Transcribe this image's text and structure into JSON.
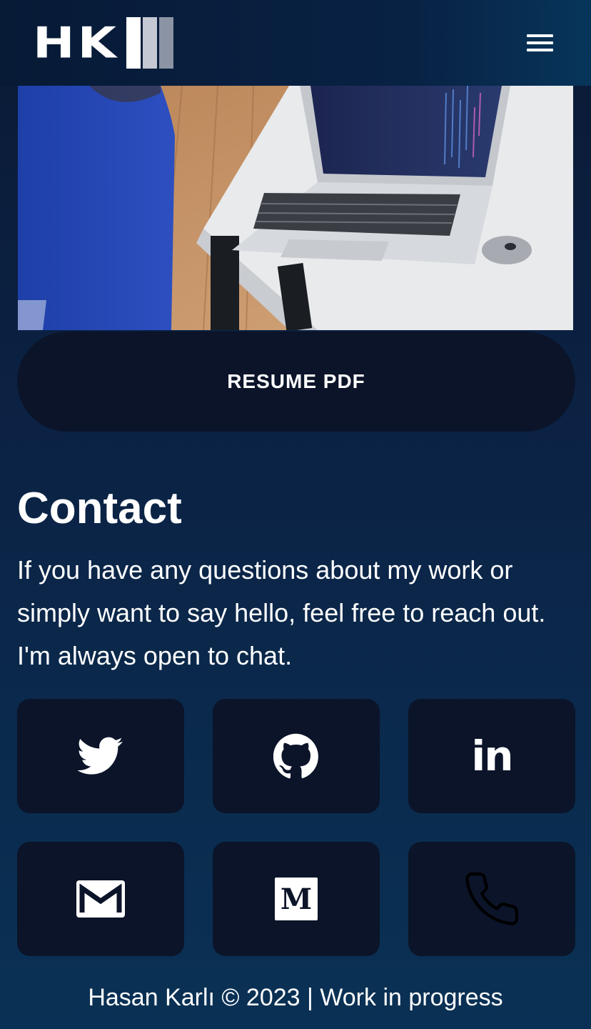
{
  "header": {
    "logo_text": "HK",
    "menu_icon": "hamburger-menu-icon"
  },
  "hero": {
    "image_subject": "person-with-laptop-photo"
  },
  "resume": {
    "label": "RESUME PDF"
  },
  "contact": {
    "title": "Contact",
    "text": "If you have any questions about my work or simply want to say hello, feel free to reach out. I'm always open to chat."
  },
  "social": [
    {
      "name": "twitter",
      "icon": "twitter-icon"
    },
    {
      "name": "github",
      "icon": "github-icon"
    },
    {
      "name": "linkedin",
      "icon": "linkedin-icon",
      "glyph": "in"
    },
    {
      "name": "email",
      "icon": "gmail-icon"
    },
    {
      "name": "medium",
      "icon": "medium-icon",
      "glyph": "M"
    },
    {
      "name": "phone",
      "icon": "phone-icon"
    }
  ],
  "footer": {
    "text": "Hasan Karlı © 2023 | Work in progress"
  },
  "colors": {
    "background": "#0b2345",
    "card": "#0b1429",
    "text": "#ffffff",
    "logo_bar_1": "#ffffff",
    "logo_bar_2": "#c3c8d2",
    "logo_bar_3": "#8b94a4"
  }
}
